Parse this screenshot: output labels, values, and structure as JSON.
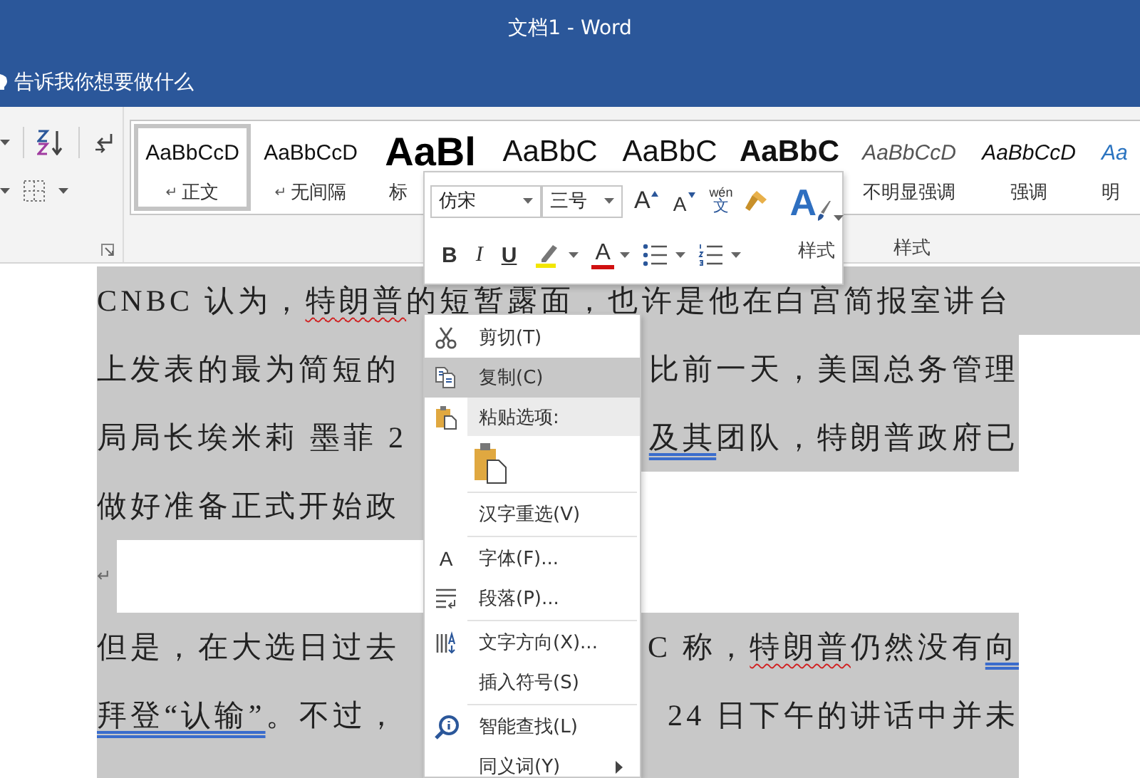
{
  "window": {
    "title": "文档1 - Word"
  },
  "tell_me": {
    "placeholder": "告诉我你想要做什么"
  },
  "styles_group": {
    "label": "样式",
    "gallery": [
      {
        "kind": "normal",
        "preview": "AaBbCcD",
        "mark": "↵",
        "label": "正文",
        "selected": true
      },
      {
        "kind": "normal",
        "preview": "AaBbCcD",
        "mark": "↵",
        "label": "无间隔",
        "selected": false
      },
      {
        "kind": "heading1",
        "preview": "AaBl",
        "label": "标",
        "selected": false
      },
      {
        "kind": "heading2",
        "preview": "AaBbC",
        "selected": false
      },
      {
        "kind": "heading2",
        "preview": "AaBbC",
        "selected": false
      },
      {
        "kind": "title",
        "preview": "AaBbC",
        "selected": false
      },
      {
        "kind": "subtle",
        "preview": "AaBbCcD",
        "label": "不明显强调",
        "selected": false
      },
      {
        "kind": "emphasis",
        "preview": "AaBbCcD",
        "label": "强调",
        "selected": false
      },
      {
        "kind": "intense",
        "preview": "Aa",
        "label": "明",
        "selected": false
      }
    ]
  },
  "mini_toolbar": {
    "font": {
      "value": "仿宋"
    },
    "size": {
      "value": "三号"
    },
    "row1": [
      {
        "kind": "grow",
        "label": "A"
      },
      {
        "kind": "shrink",
        "label": "A"
      },
      {
        "kind": "phonetic",
        "label": "wén",
        "sub": "文"
      },
      {
        "kind": "painter"
      }
    ],
    "row2": [
      {
        "kind": "bold",
        "label": "B"
      },
      {
        "kind": "italic",
        "label": "I"
      },
      {
        "kind": "underline",
        "label": "U"
      },
      {
        "kind": "highlight"
      },
      {
        "kind": "font-color",
        "label": "A"
      },
      {
        "kind": "bullets"
      },
      {
        "kind": "numbering"
      }
    ],
    "styles": {
      "glyph": "A",
      "label": "样式"
    }
  },
  "document": {
    "lines": [
      {
        "kind": "text",
        "selected": true,
        "left": [
          {
            "kind": "plain",
            "text": "CNBC 认为，"
          },
          {
            "kind": "spelling",
            "text": "特朗普"
          },
          {
            "kind": "plain",
            "text": "的短暂露面，也许是他在白宫简报室讲台"
          }
        ]
      },
      {
        "kind": "text",
        "selected": true,
        "left": [
          {
            "kind": "plain",
            "text": "上发表的最为简短的"
          }
        ],
        "right": [
          {
            "kind": "plain",
            "text": "比前一天，美国总务管理"
          }
        ]
      },
      {
        "kind": "text",
        "selected": true,
        "left": [
          {
            "kind": "plain",
            "text": "局局长埃米莉 墨菲 2"
          }
        ],
        "right": [
          {
            "kind": "grammar",
            "text": "及其"
          },
          {
            "kind": "plain",
            "text": "团队，特朗普政府已"
          }
        ]
      },
      {
        "kind": "text",
        "selected": true,
        "left": [
          {
            "kind": "plain",
            "text": "做好准备正式开始政"
          }
        ]
      },
      {
        "kind": "blank",
        "selected": true,
        "mark": "↵"
      },
      {
        "kind": "text",
        "selected": true,
        "left": [
          {
            "kind": "plain",
            "text": "但是，在大选日过去"
          }
        ],
        "right": [
          {
            "kind": "plain",
            "text": "C 称，"
          },
          {
            "kind": "spelling",
            "text": "特朗普"
          },
          {
            "kind": "plain",
            "text": "仍然没有"
          },
          {
            "kind": "grammar",
            "text": "向"
          }
        ]
      },
      {
        "kind": "text",
        "selected": true,
        "left": [
          {
            "kind": "grammar",
            "text": "拜登“认输”"
          },
          {
            "kind": "plain",
            "text": "。不过，"
          }
        ],
        "right": [
          {
            "kind": "plain",
            "text": "24 日下午的讲话中并未"
          }
        ]
      },
      {
        "kind": "text",
        "selected": true
      }
    ]
  },
  "context_menu": {
    "items": [
      {
        "kind": "command",
        "label": "剪切(T)",
        "highlighted": false,
        "submenu": false
      },
      {
        "kind": "command",
        "label": "复制(C)",
        "highlighted": true,
        "submenu": false
      },
      {
        "kind": "header",
        "label": "粘贴选项:"
      },
      {
        "kind": "paste"
      },
      {
        "kind": "separator"
      },
      {
        "kind": "command",
        "label": "汉字重选(V)",
        "highlighted": false,
        "submenu": false
      },
      {
        "kind": "separator"
      },
      {
        "kind": "command",
        "label": "字体(F)...",
        "glyph": "A",
        "highlighted": false,
        "submenu": false
      },
      {
        "kind": "command",
        "label": "段落(P)...",
        "highlighted": false,
        "submenu": false
      },
      {
        "kind": "separator"
      },
      {
        "kind": "command",
        "label": "文字方向(X)...",
        "highlighted": false,
        "submenu": false
      },
      {
        "kind": "command",
        "label": "插入符号(S)",
        "highlighted": false,
        "submenu": false
      },
      {
        "kind": "separator"
      },
      {
        "kind": "command",
        "label": "智能查找(L)",
        "highlighted": false,
        "submenu": false
      },
      {
        "kind": "command",
        "label": "同义词(Y)",
        "highlighted": false,
        "submenu": true
      }
    ]
  }
}
